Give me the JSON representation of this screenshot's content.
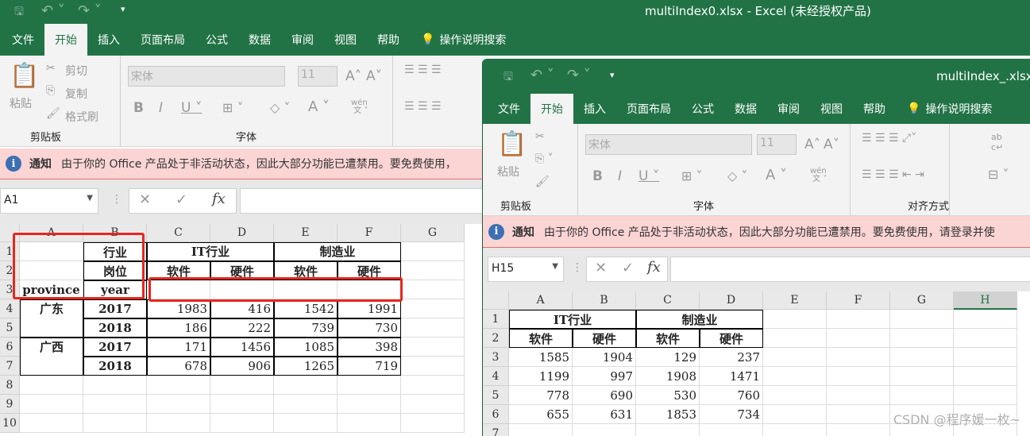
{
  "left_window": {
    "title": "multiIndex0.xlsx  -  Excel (未经授权产品)",
    "tabs": [
      "文件",
      "开始",
      "插入",
      "页面布局",
      "公式",
      "数据",
      "审阅",
      "视图",
      "帮助"
    ],
    "active_tab": "开始",
    "tell_me": "操作说明搜索",
    "clipboard": {
      "paste": "粘贴",
      "cut": "剪切",
      "copy": "复制",
      "format_painter": "格式刷",
      "label": "剪贴板"
    },
    "font": {
      "name": "宋体",
      "size": "11",
      "label": "字体",
      "phonetic": "wén\n文"
    },
    "notice": {
      "title": "通知",
      "text": "由于你的 Office 产品处于非活动状态，因此大部分功能已遭禁用。要免费使用，"
    },
    "name_box": "A1",
    "columns": [
      "A",
      "B",
      "C",
      "D",
      "E",
      "F",
      "G"
    ],
    "rows": [
      "1",
      "2",
      "3",
      "4",
      "5",
      "6",
      "7",
      "8",
      "9",
      "10"
    ],
    "cells": [
      [
        "",
        "行业",
        "IT行业",
        "",
        "制造业",
        ""
      ],
      [
        "",
        "岗位",
        "软件",
        "硬件",
        "软件",
        "硬件"
      ],
      [
        "province",
        "year",
        "",
        "",
        "",
        ""
      ],
      [
        "广东",
        "2017",
        "1983",
        "416",
        "1542",
        "1991"
      ],
      [
        "",
        "2018",
        "186",
        "222",
        "739",
        "730"
      ],
      [
        "广西",
        "2017",
        "171",
        "1456",
        "1085",
        "398"
      ],
      [
        "",
        "2018",
        "678",
        "906",
        "1265",
        "719"
      ]
    ]
  },
  "right_window": {
    "title": "multiIndex_.xlsx",
    "tabs": [
      "文件",
      "开始",
      "插入",
      "页面布局",
      "公式",
      "数据",
      "审阅",
      "视图",
      "帮助"
    ],
    "active_tab": "开始",
    "tell_me": "操作说明搜索",
    "clipboard": {
      "paste": "粘贴",
      "label": "剪贴板"
    },
    "font": {
      "name": "宋体",
      "size": "11",
      "label": "字体"
    },
    "alignment_label": "对齐方式",
    "notice": {
      "title": "通知",
      "text": "由于你的 Office 产品处于非活动状态，因此大部分功能已遭禁用。要免费使用，请登录并使"
    },
    "name_box": "H15",
    "selected_column": "H",
    "columns": [
      "A",
      "B",
      "C",
      "D",
      "E",
      "F",
      "G",
      "H"
    ],
    "rows": [
      "1",
      "2",
      "3",
      "4",
      "5",
      "6",
      "7"
    ],
    "cells": [
      [
        "IT行业",
        "",
        "制造业",
        ""
      ],
      [
        "软件",
        "硬件",
        "软件",
        "硬件"
      ],
      [
        "1585",
        "1904",
        "129",
        "237"
      ],
      [
        "1199",
        "997",
        "1908",
        "1471"
      ],
      [
        "778",
        "690",
        "530",
        "760"
      ],
      [
        "655",
        "631",
        "1853",
        "734"
      ]
    ]
  },
  "watermark": "CSDN @程序媛一枚~",
  "colors": {
    "excel_green": "#217346",
    "highlight_red": "#e8261f",
    "notice_bg": "#fbd4d4"
  }
}
